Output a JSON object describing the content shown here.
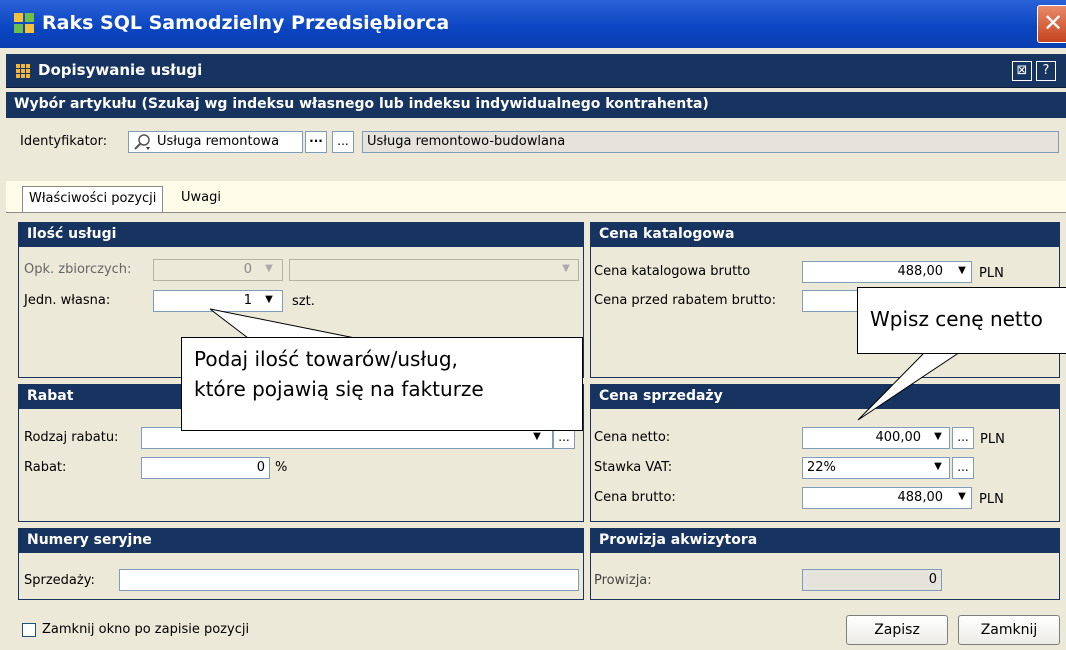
{
  "window": {
    "title": "Raks SQL Samodzielny Przedsiębiorca",
    "close_glyph": "✕"
  },
  "subwindow": {
    "title": "Dopisywanie usługi",
    "btn_a": "⊠",
    "btn_help": "?"
  },
  "article": {
    "header": "Wybór artykułu (Szukaj wg indeksu własnego lub indeksu indywidualnego kontrahenta)",
    "identifier_label": "Identyfikator:",
    "identifier_value": "Usługa remontowa",
    "more_glyph": "···",
    "ellipsis": "...",
    "description": "Usługa remontowo-budowlana"
  },
  "tabs": [
    "Właściwości pozycji",
    "Uwagi"
  ],
  "quantity": {
    "header": "Ilość usługi",
    "bulk_label": "Opk. zbiorczych:",
    "bulk_value": "0",
    "own_unit_label": "Jedn. własna:",
    "own_unit_value": "1",
    "unit": "szt."
  },
  "catalog_price": {
    "header": "Cena katalogowa",
    "gross_label": "Cena katalogowa brutto",
    "gross_value": "488,00",
    "currency": "PLN",
    "before_discount_label": "Cena przed rabatem brutto:"
  },
  "discount": {
    "header": "Rabat",
    "type_label": "Rodzaj rabatu:",
    "type_value": "",
    "discount_label": "Rabat:",
    "discount_value": "0",
    "percent": "%"
  },
  "sale_price": {
    "header": "Cena sprzedaży",
    "net_label": "Cena netto:",
    "net_value": "400,00",
    "vat_label": "Stawka VAT:",
    "vat_value": "22%",
    "gross_label": "Cena brutto:",
    "gross_value": "488,00",
    "currency": "PLN"
  },
  "serials": {
    "header": "Numery seryjne",
    "sales_label": "Sprzedaży:",
    "sales_value": ""
  },
  "commission": {
    "header": "Prowizja akwizytora",
    "label": "Prowizja:",
    "value": "0"
  },
  "footer": {
    "close_after_save": "Zamknij okno po zapisie pozycji",
    "save": "Zapisz",
    "close": "Zamknij"
  },
  "callouts": {
    "quantity_line1": "Podaj ilość towarów/usług,",
    "quantity_line2": "które pojawią się na fakturze",
    "net_price": "Wpisz cenę netto"
  },
  "dropdown_glyph": "▼",
  "icons": {
    "search": "search-icon",
    "dropdown": "chevron-down-icon",
    "app": "app-logo-icon",
    "grid": "grid-icon"
  }
}
